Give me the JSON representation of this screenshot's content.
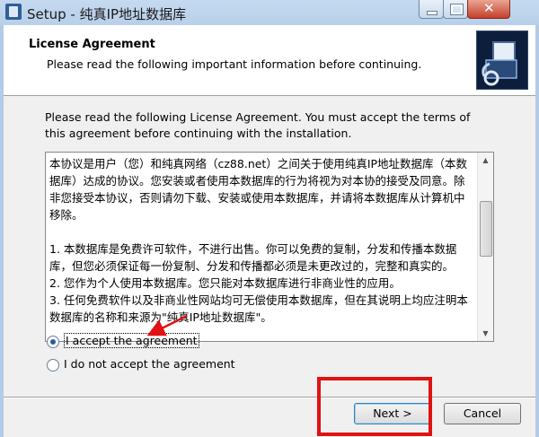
{
  "window": {
    "title": "Setup - 纯真IP地址数据库",
    "close_glyph": "✕"
  },
  "header": {
    "title": "License Agreement",
    "subtitle": "Please read the following important information before continuing."
  },
  "intro": "Please read the following License Agreement. You must accept the terms of this agreement before continuing with the installation.",
  "license_text": "本协议是用户（您）和纯真网络（cz88.net）之间关于使用纯真IP地址数据库（本数据库）达成的协议。您安装或者使用本数据库的行为将视为对本协的接受及同意。除非您接受本协议，否则请勿下载、安装或使用本数据库，并请将本数据库从计算机中移除。\n\n1. 本数据库是免费许可软件，不进行出售。你可以免费的复制，分发和传播本数据库，但您必须保证每一份复制、分发和传播都必须是未更改过的，完整和真实的。\n2. 您作为个人使用本数据库。您只能对本数据库进行非商业性的应用。\n3. 任何免费软件以及非商业性网站均可无偿使用本数据库，但在其说明上均应注明本数据库的名称和来源为\"纯真IP地址数据库\"。",
  "radios": {
    "accept": "I accept the agreement",
    "decline": "I do not accept the agreement",
    "selected": "accept"
  },
  "buttons": {
    "next": "Next >",
    "cancel": "Cancel"
  },
  "annotation_color": "#e01212"
}
